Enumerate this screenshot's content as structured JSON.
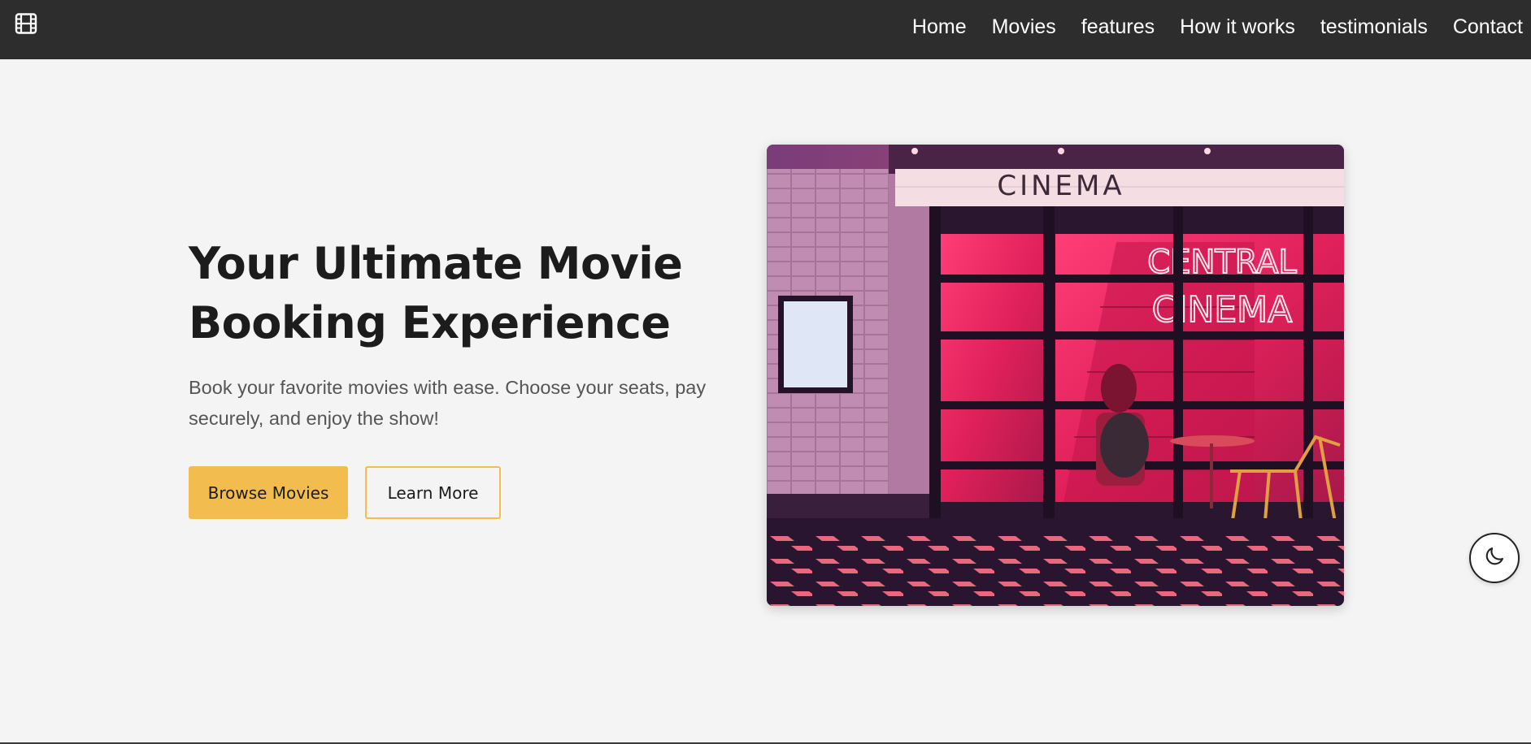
{
  "header": {
    "logo_icon": "film-icon",
    "nav": [
      "Home",
      "Movies",
      "features",
      "How it works",
      "testimonials",
      "Contact"
    ]
  },
  "hero": {
    "title": "Your Ultimate Movie Booking Experience",
    "subtitle": "Book your favorite movies with ease. Choose your seats, pay securely, and enjoy the show!",
    "primary_button": "Browse Movies",
    "secondary_button": "Learn More",
    "image_sign_top": "CINEMA",
    "image_neon_line1": "CENTRAL",
    "image_neon_line2": "CINEMA"
  },
  "theme_toggle": {
    "icon": "moon-icon"
  },
  "colors": {
    "nav_bg": "#2d2d2d",
    "page_bg": "#f4f4f4",
    "accent": "#f2bd4e",
    "title": "#1c1c1c",
    "subtitle": "#555555"
  }
}
